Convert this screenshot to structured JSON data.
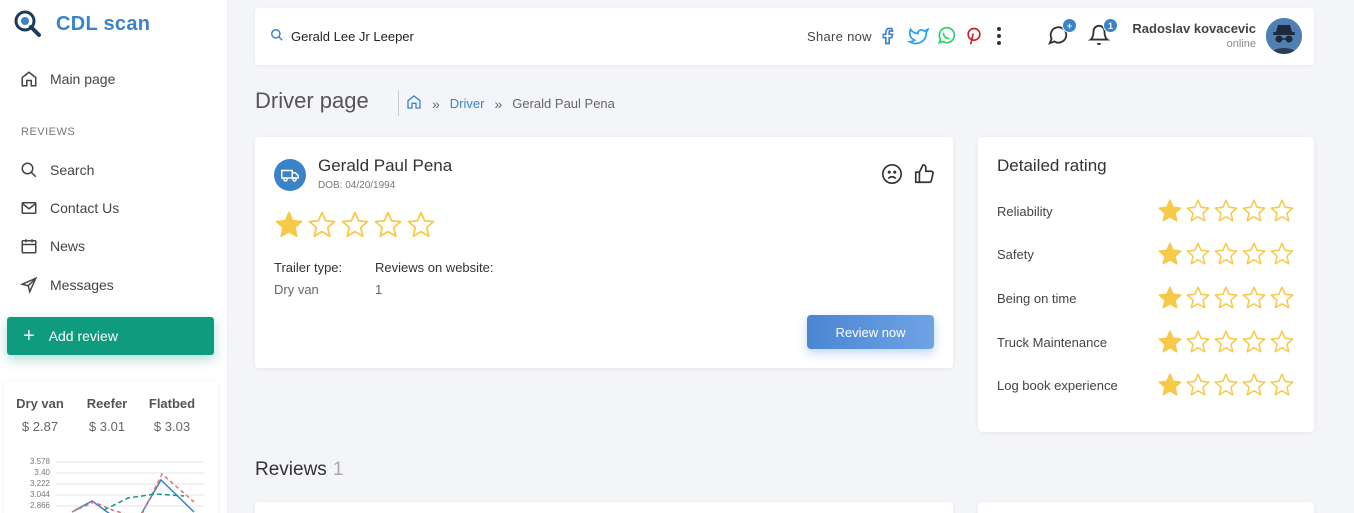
{
  "app": {
    "name": "CDL scan"
  },
  "sidebar": {
    "main_page": "Main page",
    "section_label": "REVIEWS",
    "items": [
      {
        "label": "Search",
        "icon": "search-icon"
      },
      {
        "label": "Contact Us",
        "icon": "mail-icon"
      },
      {
        "label": "News",
        "icon": "calendar-icon"
      },
      {
        "label": "Messages",
        "icon": "send-icon"
      }
    ],
    "add_review": "Add review",
    "rates": [
      {
        "name": "Dry van",
        "value": "$ 2.87"
      },
      {
        "name": "Reefer",
        "value": "$ 3.01"
      },
      {
        "name": "Flatbed",
        "value": "$ 3.03"
      }
    ],
    "mini_chart_ticks": [
      "3.578",
      "3.40",
      "3.222",
      "3.044",
      "2.866"
    ]
  },
  "topbar": {
    "search_value": "Gerald Lee Jr Leeper",
    "share_label": "Share now",
    "social": [
      "facebook-icon",
      "twitter-icon",
      "whatsapp-icon",
      "pinterest-icon"
    ],
    "chat_badge": "+",
    "notif_badge": "1",
    "user_name": "Radoslav kovacevic",
    "user_status": "online"
  },
  "breadcrumb": {
    "page_title": "Driver page",
    "link": "Driver",
    "current": "Gerald Paul Pena",
    "separator": "»"
  },
  "driver": {
    "name": "Gerald Paul Pena",
    "dob": "DOB: 04/20/1994",
    "rating": 1,
    "rating_max": 5,
    "trailer_label": "Trailer type:",
    "trailer_value": "Dry van",
    "reviews_label": "Reviews on website:",
    "reviews_value": "1",
    "review_button": "Review now"
  },
  "detailed_rating": {
    "title": "Detailed rating",
    "rows": [
      {
        "label": "Reliability",
        "value": 1
      },
      {
        "label": "Safety",
        "value": 1
      },
      {
        "label": "Being on time",
        "value": 1
      },
      {
        "label": "Truck Maintenance",
        "value": 1
      },
      {
        "label": "Log book experience",
        "value": 1
      }
    ]
  },
  "reviews": {
    "title": "Reviews",
    "count": "1"
  },
  "colors": {
    "accent": "#3a83c9",
    "green": "#0f9b7d",
    "star": "#f7c948"
  }
}
